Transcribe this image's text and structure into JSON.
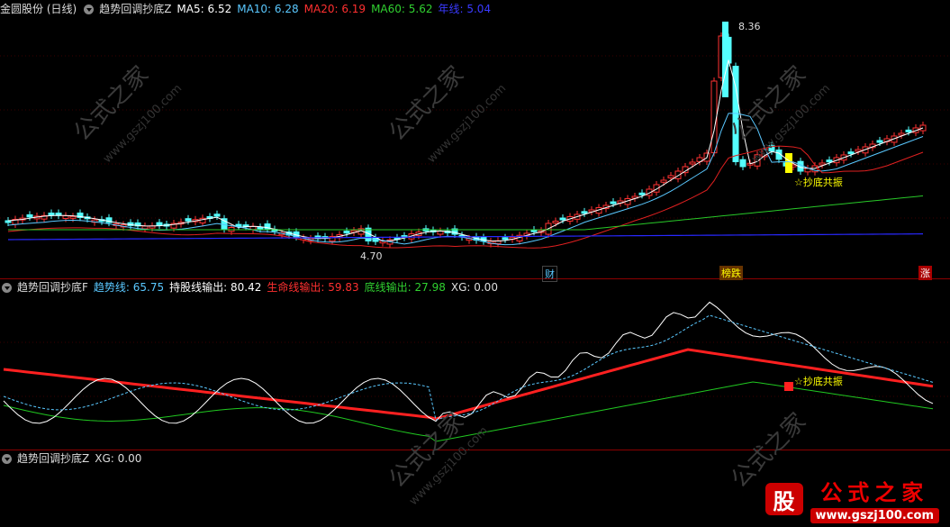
{
  "top": {
    "stock": "金圆股份 (日线)",
    "indicator": "趋势回调抄底Z",
    "ma5_label": "MA5:",
    "ma5": "6.52",
    "ma10_label": "MA10:",
    "ma10": "6.28",
    "ma20_label": "MA20:",
    "ma20": "6.19",
    "ma60_label": "MA60:",
    "ma60": "5.62",
    "year_label": "年线:",
    "year": "5.04",
    "high_label": "8.36",
    "low_label": "4.70",
    "signal": "☆抄底共振",
    "markers": [
      "财",
      "榜跌",
      "涨"
    ]
  },
  "mid": {
    "indicator": "趋势回调抄底F",
    "trend_label": "趋势线:",
    "trend": "65.75",
    "hold_label": "持股线输出:",
    "hold": "80.42",
    "life_label": "生命线输出:",
    "life": "59.83",
    "bottom_label": "底线输出:",
    "bottom": "27.98",
    "xg_label": "XG:",
    "xg": "0.00",
    "signal": "☆抄底共振"
  },
  "bot": {
    "indicator": "趋势回调抄底Z",
    "xg_label": "XG:",
    "xg": "0.00"
  },
  "watermark": {
    "text": "公式之家",
    "url": "www.gszj100.com"
  },
  "logo": {
    "seal": "股",
    "title": "公式之家",
    "url": "www.gszj100.com"
  },
  "colors": {
    "up": "#ff3232",
    "down": "#54ffff",
    "ma5": "#ffffff",
    "ma10": "#5ac8ff",
    "ma20": "#e02020",
    "ma60": "#28c828",
    "year": "#2828ff",
    "signal": "#ffff00"
  }
}
